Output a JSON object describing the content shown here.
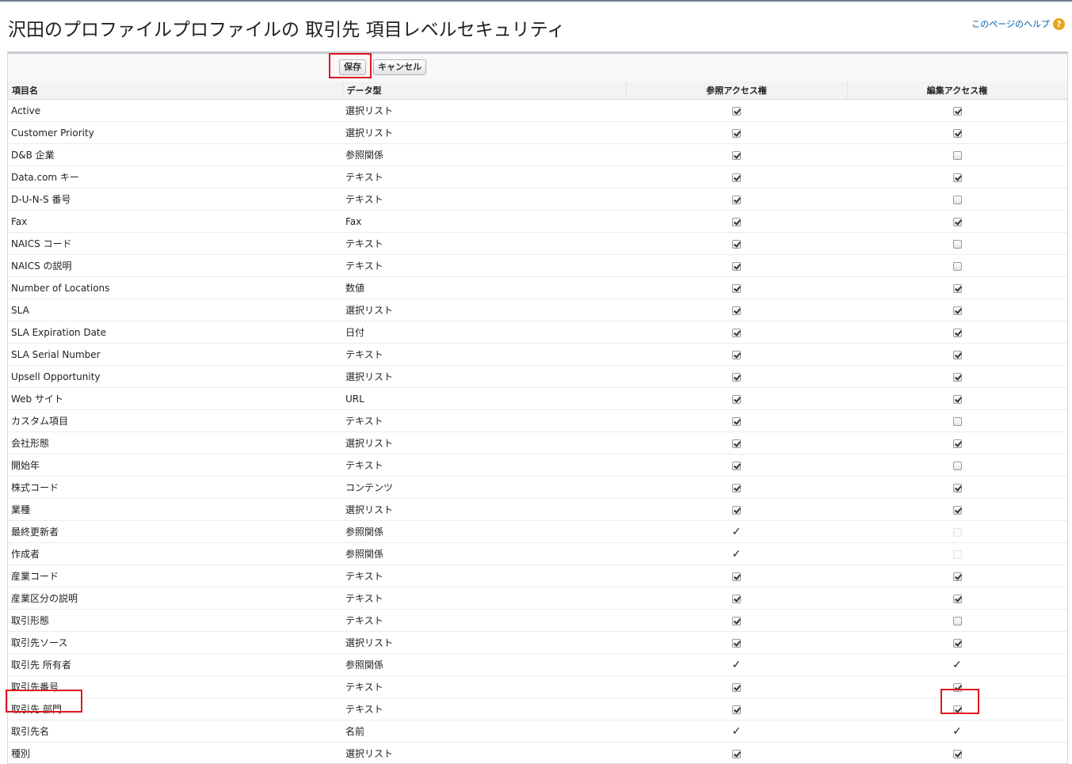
{
  "page": {
    "title": "沢田のプロファイルプロファイルの 取引先 項目レベルセキュリティ",
    "help_label": "このページのヘルプ",
    "help_icon": "?"
  },
  "toolbar": {
    "save_label": "保存",
    "cancel_label": "キャンセル"
  },
  "columns": {
    "field_name": "項目名",
    "data_type": "データ型",
    "read_access": "参照アクセス権",
    "edit_access": "編集アクセス権"
  },
  "check_glyph": "✓",
  "rows": [
    {
      "name": "Active",
      "type": "選択リスト",
      "read": "checked",
      "edit": "checked"
    },
    {
      "name": "Customer Priority",
      "type": "選択リスト",
      "read": "checked",
      "edit": "checked"
    },
    {
      "name": "D&B 企業",
      "type": "参照関係",
      "read": "checked",
      "edit": "unchecked"
    },
    {
      "name": "Data.com キー",
      "type": "テキスト",
      "read": "checked",
      "edit": "checked"
    },
    {
      "name": "D-U-N-S 番号",
      "type": "テキスト",
      "read": "checked",
      "edit": "unchecked"
    },
    {
      "name": "Fax",
      "type": "Fax",
      "read": "checked",
      "edit": "checked"
    },
    {
      "name": "NAICS コード",
      "type": "テキスト",
      "read": "checked",
      "edit": "unchecked"
    },
    {
      "name": "NAICS の説明",
      "type": "テキスト",
      "read": "checked",
      "edit": "unchecked"
    },
    {
      "name": "Number of Locations",
      "type": "数値",
      "read": "checked",
      "edit": "checked"
    },
    {
      "name": "SLA",
      "type": "選択リスト",
      "read": "checked",
      "edit": "checked"
    },
    {
      "name": "SLA Expiration Date",
      "type": "日付",
      "read": "checked",
      "edit": "checked"
    },
    {
      "name": "SLA Serial Number",
      "type": "テキスト",
      "read": "checked",
      "edit": "checked"
    },
    {
      "name": "Upsell Opportunity",
      "type": "選択リスト",
      "read": "checked",
      "edit": "checked"
    },
    {
      "name": "Web サイト",
      "type": "URL",
      "read": "checked",
      "edit": "checked"
    },
    {
      "name": "カスタム項目",
      "type": "テキスト",
      "read": "checked",
      "edit": "unchecked"
    },
    {
      "name": "会社形態",
      "type": "選択リスト",
      "read": "checked",
      "edit": "checked"
    },
    {
      "name": "開始年",
      "type": "テキスト",
      "read": "checked",
      "edit": "unchecked"
    },
    {
      "name": "株式コード",
      "type": "コンテンツ",
      "read": "checked",
      "edit": "checked"
    },
    {
      "name": "業種",
      "type": "選択リスト",
      "read": "checked",
      "edit": "checked"
    },
    {
      "name": "最終更新者",
      "type": "参照関係",
      "read": "fixed",
      "edit": "disabled"
    },
    {
      "name": "作成者",
      "type": "参照関係",
      "read": "fixed",
      "edit": "disabled"
    },
    {
      "name": "産業コード",
      "type": "テキスト",
      "read": "checked",
      "edit": "checked"
    },
    {
      "name": "産業区分の説明",
      "type": "テキスト",
      "read": "checked",
      "edit": "checked"
    },
    {
      "name": "取引形態",
      "type": "テキスト",
      "read": "checked",
      "edit": "unchecked"
    },
    {
      "name": "取引先ソース",
      "type": "選択リスト",
      "read": "checked",
      "edit": "checked"
    },
    {
      "name": "取引先 所有者",
      "type": "参照関係",
      "read": "fixed",
      "edit": "fixed"
    },
    {
      "name": "取引先番号",
      "type": "テキスト",
      "read": "checked",
      "edit": "checked"
    },
    {
      "name": "取引先 部門",
      "type": "テキスト",
      "read": "checked",
      "edit": "checked"
    },
    {
      "name": "取引先名",
      "type": "名前",
      "read": "fixed",
      "edit": "fixed"
    },
    {
      "name": "種別",
      "type": "選択リスト",
      "read": "checked",
      "edit": "checked"
    }
  ]
}
